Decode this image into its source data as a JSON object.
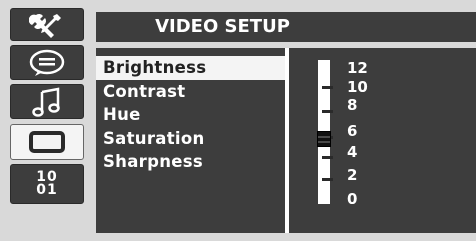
{
  "header": {
    "title": "VIDEO SETUP"
  },
  "sidebar": {
    "tabs": [
      {
        "icon": "tools-icon"
      },
      {
        "icon": "speech-bubble-icon"
      },
      {
        "icon": "music-note-icon"
      },
      {
        "icon": "monitor-icon",
        "selected": true
      },
      {
        "icon": "binary-icon",
        "text": "10\n01"
      }
    ]
  },
  "menu": {
    "items": [
      {
        "label": "Brightness",
        "selected": true
      },
      {
        "label": "Contrast"
      },
      {
        "label": "Hue"
      },
      {
        "label": "Saturation"
      },
      {
        "label": "Sharpness"
      }
    ]
  },
  "slider": {
    "scale_labels": [
      "12",
      "10",
      "8",
      "6",
      "4",
      "2",
      "0"
    ],
    "range": [
      0,
      12
    ],
    "value": 6
  },
  "colors": {
    "background": "#d9d9d9",
    "panel": "#3d3d3d",
    "highlight": "#f4f4f4",
    "text": "#ffffff"
  }
}
